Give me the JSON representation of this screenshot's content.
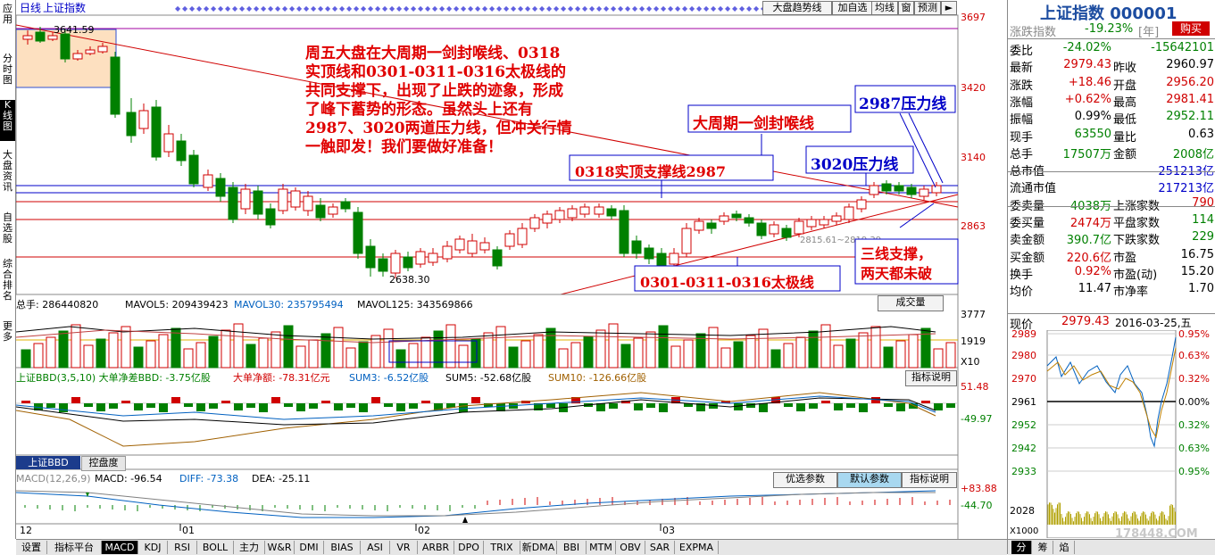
{
  "sidebar": {
    "items": [
      "应用",
      "分时图",
      "K线图",
      "大盘资讯",
      "自选股",
      "综合排名",
      "更多"
    ]
  },
  "header": {
    "period": "日线",
    "name": "上证指数",
    "buttons": [
      "大盘趋势线",
      "加自选",
      "均线",
      "窗",
      "预测"
    ]
  },
  "price_axis": [
    "3697",
    "3420",
    "3140",
    "2863"
  ],
  "kline": {
    "high_label": "3641.59",
    "low_label": "2638.30",
    "mid_label": "2815.61~2819.39"
  },
  "annotations": {
    "main_text": "周五大盘在大周期一剑封喉线、0318实顶线和0301-0311-0316太极线的共同支撑下，出现了止跌的迹象，形成了峰下蓄势的形态。虽然头上还有2987、3020两道压力线，但冲关行情一触即发！我们要做好准备！",
    "line1": "大周期一剑封喉线",
    "line2": "2987压力线",
    "line3": "3020压力线",
    "line4": "0318实顶支撑线2987",
    "line5": "0301-0311-0316太极线",
    "line6a": "三线支撑，",
    "line6b": "两天都未破"
  },
  "volume": {
    "total": "总手: 286440820",
    "ma5": "MAVOL5: 209439423",
    "ma30": "MAVOL30: 235795494",
    "ma125": "MAVOL125: 343569866",
    "button": "成交量",
    "axis": [
      "3777",
      "1919"
    ],
    "unit": "X10"
  },
  "bbd": {
    "title": "上证BBD(3,5,10) 大单净差BBD: -3.75亿股",
    "amount": "大单净额: -78.31亿元",
    "sum3": "SUM3: -6.52亿股",
    "sum5": "SUM5: -52.68亿股",
    "sum10": "SUM10: -126.66亿股",
    "button": "指标说明",
    "axis": [
      "51.48",
      "-49.97"
    ]
  },
  "subtabs": [
    "上证BBD",
    "控盘度"
  ],
  "macd": {
    "title": "MACD(12,26,9)",
    "macd": "MACD: -96.54",
    "diff": "DIFF: -73.38",
    "dea": "DEA: -25.11",
    "buttons": [
      "优选参数",
      "默认参数",
      "指标说明"
    ],
    "axis": [
      "+83.88",
      "-44.70"
    ]
  },
  "date_axis": [
    "12",
    "01",
    "02",
    "03"
  ],
  "bottom_tabs": [
    "设置",
    "指标平台",
    "MACD",
    "KDJ",
    "RSI",
    "BOLL",
    "主力",
    "W&R",
    "DMI",
    "BIAS",
    "ASI",
    "VR",
    "ARBR",
    "DPO",
    "TRIX",
    "新DMA",
    "BBI",
    "MTM",
    "OBV",
    "SAR",
    "EXPMA"
  ],
  "right": {
    "title": "上证指数 000001",
    "sub_label": "涨跌指数",
    "sub_value": "-19.23%",
    "sub_unit": "[年]",
    "buy": "购买",
    "rows": [
      [
        "委比",
        "-24.02%",
        "",
        "-15642101"
      ],
      [
        "最新",
        "2979.43",
        "昨收",
        "2960.97"
      ],
      [
        "涨跌",
        "+18.46",
        "开盘",
        "2956.20"
      ],
      [
        "涨幅",
        "+0.62%",
        "最高",
        "2981.41"
      ],
      [
        "振幅",
        "0.99%",
        "最低",
        "2952.11"
      ],
      [
        "现手",
        "63550",
        "量比",
        "0.63"
      ],
      [
        "总手",
        "17507万",
        "金额",
        "2008亿"
      ],
      [
        "总市值",
        "",
        "",
        "251213亿"
      ],
      [
        "流通市值",
        "",
        "",
        "217213亿"
      ],
      [
        "委卖量",
        "4038万",
        "上涨家数",
        "790"
      ],
      [
        "委买量",
        "2474万",
        "平盘家数",
        "114"
      ],
      [
        "卖金额",
        "390.7亿",
        "下跌家数",
        "229"
      ],
      [
        "买金额",
        "220.6亿",
        "市盈",
        "16.75"
      ],
      [
        "换手",
        "0.92%",
        "市盈(动)",
        "15.20"
      ],
      [
        "均价",
        "11.47",
        "市净率",
        "1.70"
      ]
    ],
    "now_label": "现价",
    "now_value": "2979.43",
    "date": "2016-03-25,五",
    "mini_left": [
      "2989",
      "2980",
      "2970",
      "2961",
      "2952",
      "2942",
      "2933",
      "2028"
    ],
    "mini_right": [
      "0.95%",
      "0.63%",
      "0.32%",
      "0.00%",
      "0.32%",
      "0.63%",
      "0.95%"
    ],
    "mini_unit": "X1000",
    "tabs": [
      "分",
      "筹",
      "焰"
    ],
    "watermark": "178448.COM"
  },
  "colors": {
    "up": "#d00000",
    "down": "#008000",
    "blue": "#0000c8",
    "ann_red": "#e00000"
  }
}
